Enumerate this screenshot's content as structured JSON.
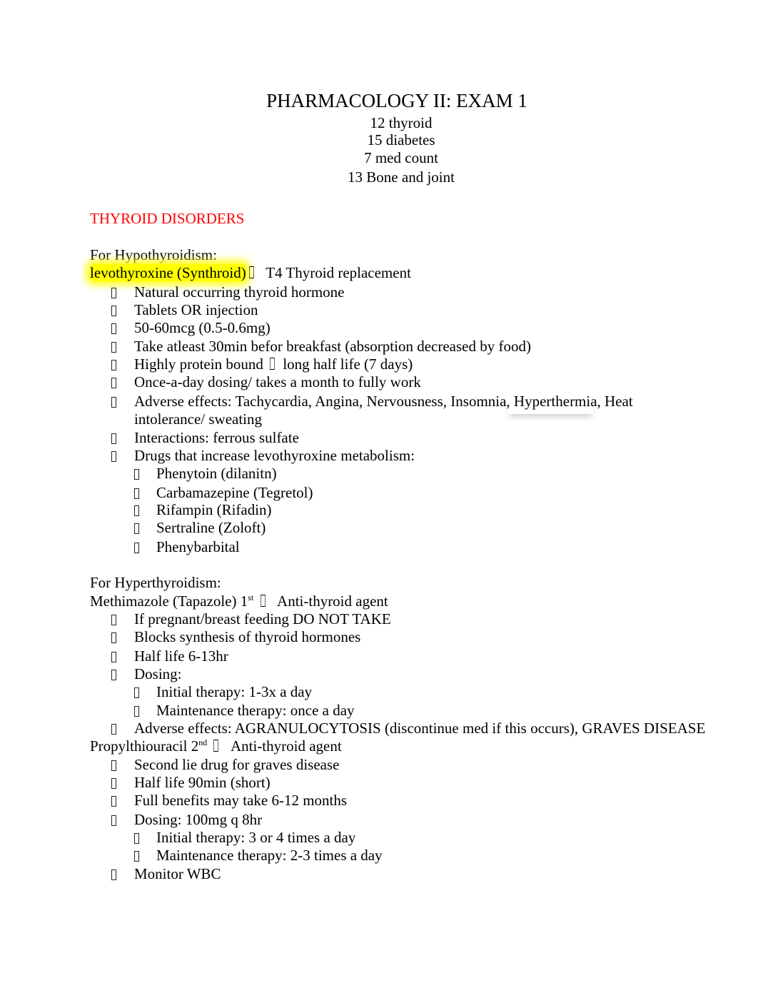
{
  "header": {
    "title": "PHARMACOLOGY II: EXAM 1",
    "counts": [
      "12 thyroid",
      "15 diabetes",
      "7 med count",
      "13 Bone and joint"
    ]
  },
  "section": {
    "heading": "THYROID DISORDERS",
    "heading_color": "#ff0000"
  },
  "hypo": {
    "label": "For Hypothyroidism:",
    "drug": "levothyroxine (Synthroid)",
    "drug_highlight": "#ffff00",
    "drug_desc": "T4 Thyroid replacement",
    "bullets": [
      "Natural occurring thyroid hormone",
      "Tablets OR injection",
      "50-60mcg (0.5-0.6mg)",
      "Take atleast 30min befor breakfast (absorption decreased by food)",
      "Highly protein bound",
      "Once-a-day dosing/ takes a month to fully work",
      "Adverse effects: Tachycardia, Angina, Nervousness, Insomnia, Hyperthermia, Heat intolerance/ sweating",
      "Interactions: ferrous sulfate",
      "Drugs that increase levothyroxine metabolism:"
    ],
    "protein_bound_suffix": "long half life (7 days)",
    "adverse_line1": "Adverse effects: Tachycardia, Angina, Nervousness, Insomnia, Hyperthermia, Heat",
    "adverse_line2": "intolerance/ sweating",
    "metabolism_drugs": [
      "Phenytoin (dilanitn)",
      "Carbamazepine (Tegretol)",
      "Rifampin (Rifadin)",
      "Sertraline (Zoloft)",
      "Phenybarbital"
    ]
  },
  "hyper": {
    "label": "For Hyperthyroidism:",
    "methimazole": {
      "name": "Methimazole (Tapazole) 1",
      "sup": "st",
      "desc": "Anti-thyroid agent",
      "bullets": [
        "If pregnant/breast feeding DO NOT TAKE",
        "Blocks synthesis of thyroid hormones",
        "Half life 6-13hr",
        "Dosing:"
      ],
      "dosing": [
        "Initial therapy: 1-3x a day",
        "Maintenance therapy: once a day"
      ],
      "adverse": "Adverse effects:  AGRANULOCYTOSIS (discontinue med if this occurs), GRAVES DISEASE"
    },
    "ptu": {
      "name": "Propylthiouracil 2",
      "sup": "nd",
      "desc": "Anti-thyroid agent",
      "bullets": [
        "Second lie drug for graves disease",
        "Half life 90min (short)",
        "Full benefits may take 6-12 months",
        "Dosing: 100mg q 8hr"
      ],
      "dosing": [
        "Initial therapy: 3 or 4 times a day",
        "Maintenance therapy: 2-3 times a day"
      ],
      "monitor": "Monitor WBC"
    }
  }
}
